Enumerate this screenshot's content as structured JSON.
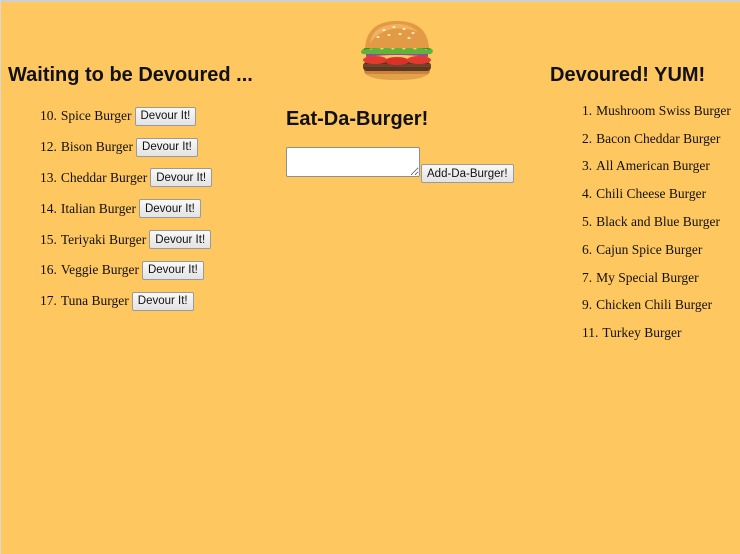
{
  "waiting": {
    "heading": "Waiting to be Devoured ...",
    "items": [
      {
        "num": "10.",
        "name": "Spice Burger",
        "button_label": "Devour It!"
      },
      {
        "num": "12.",
        "name": "Bison Burger",
        "button_label": "Devour It!"
      },
      {
        "num": "13.",
        "name": "Cheddar Burger",
        "button_label": "Devour It!"
      },
      {
        "num": "14.",
        "name": "Italian Burger",
        "button_label": "Devour It!"
      },
      {
        "num": "15.",
        "name": "Teriyaki Burger",
        "button_label": "Devour It!"
      },
      {
        "num": "16.",
        "name": "Veggie Burger",
        "button_label": "Devour It!"
      },
      {
        "num": "17.",
        "name": "Tuna Burger",
        "button_label": "Devour It!"
      }
    ]
  },
  "main": {
    "title": "Eat-Da-Burger!",
    "input_value": "",
    "add_button_label": "Add-Da-Burger!"
  },
  "devoured": {
    "heading": "Devoured! YUM!",
    "items": [
      {
        "num": "1.",
        "name": "Mushroom Swiss Burger"
      },
      {
        "num": "2.",
        "name": "Bacon Cheddar Burger"
      },
      {
        "num": "3.",
        "name": "All American Burger"
      },
      {
        "num": "4.",
        "name": "Chili Cheese Burger"
      },
      {
        "num": "5.",
        "name": "Black and Blue Burger"
      },
      {
        "num": "6.",
        "name": "Cajun Spice Burger"
      },
      {
        "num": "7.",
        "name": "My Special Burger"
      },
      {
        "num": "9.",
        "name": "Chicken Chili Burger"
      },
      {
        "num": "11.",
        "name": "Turkey Burger"
      }
    ]
  },
  "colors": {
    "background": "#ffc760",
    "text": "#111111"
  },
  "icons": {
    "header_image": "burger-image"
  }
}
